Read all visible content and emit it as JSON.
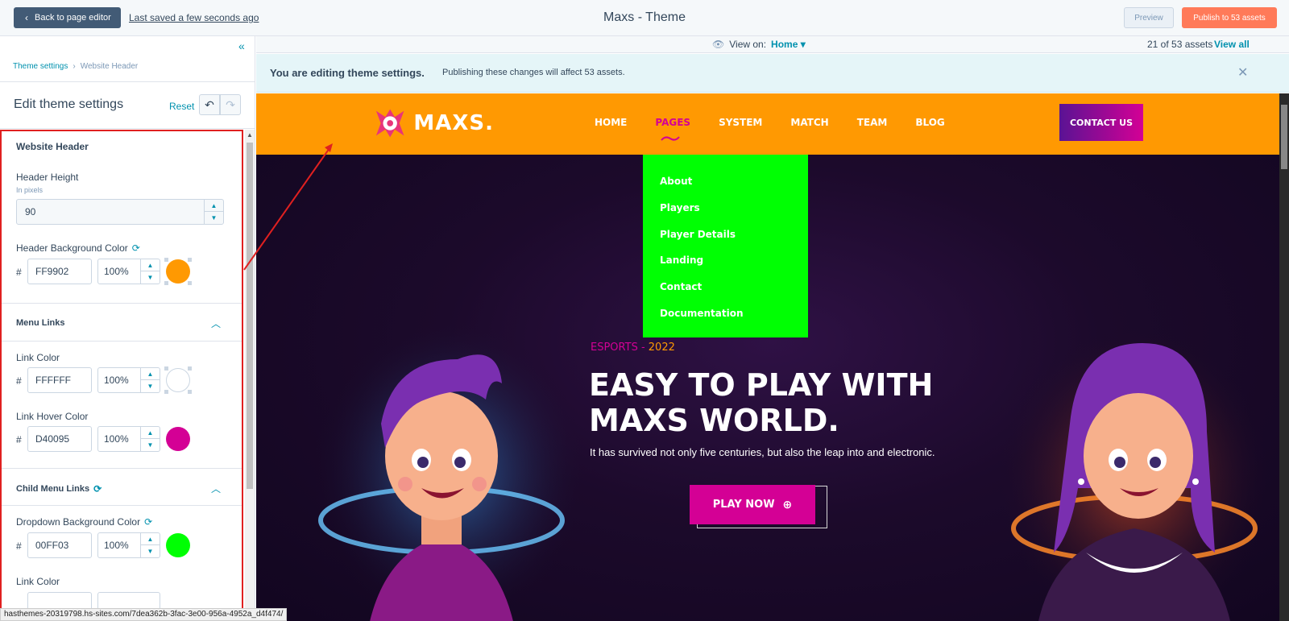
{
  "topbar": {
    "back_label": "Back to page editor",
    "saved_label": "Last saved a few seconds ago",
    "app_title": "Maxs - Theme",
    "preview_label": "Preview",
    "publish_label": "Publish to 53 assets"
  },
  "sidebar": {
    "breadcrumb": [
      "Theme settings",
      "Website Header"
    ],
    "title": "Edit theme settings",
    "reset_label": "Reset",
    "sections": {
      "website_header": {
        "title": "Website Header",
        "height_label": "Header Height",
        "height_sub": "In pixels",
        "height_value": "90",
        "bg_label": "Header Background Color",
        "bg_hex": "FF9902",
        "bg_opacity": "100%",
        "bg_color": "#ff9902"
      },
      "menu_links": {
        "title": "Menu Links",
        "link_label": "Link Color",
        "link_hex": "FFFFFF",
        "link_opacity": "100%",
        "link_color": "#ffffff",
        "hover_label": "Link Hover Color",
        "hover_hex": "D40095",
        "hover_opacity": "100%",
        "hover_color": "#d40095"
      },
      "child_menu_links": {
        "title": "Child Menu Links",
        "dropdown_label": "Dropdown Background Color",
        "dropdown_hex": "00FF03",
        "dropdown_opacity": "100%",
        "dropdown_color": "#00ff03",
        "link_label": "Link Color"
      }
    }
  },
  "viewbar": {
    "view_on_label": "View on:",
    "view_on_value": "Home",
    "assets_count": "21 of 53 assets",
    "view_all_label": "View all"
  },
  "notice": {
    "title": "You are editing theme settings.",
    "text": "Publishing these changes will affect 53 assets."
  },
  "site": {
    "logo_text": "MAXS.",
    "nav": [
      "HOME",
      "PAGES",
      "SYSTEM",
      "MATCH",
      "TEAM",
      "BLOG"
    ],
    "active_nav": "PAGES",
    "contact_label": "CONTACT US",
    "dropdown": [
      "About",
      "Players",
      "Player Details",
      "Landing",
      "Contact",
      "Documentation"
    ],
    "esports_label": "ESPORTS - ",
    "esports_year": "2022",
    "hero_title_line1": "EASY TO PLAY WITH",
    "hero_title_line2": "MAXS WORLD.",
    "hero_sub": "It has survived not only five centuries, but also the leap into and electronic.",
    "play_label": "PLAY NOW"
  },
  "status_url": "hasthemes-20319798.hs-sites.com/7dea362b-3fac-3e00-956a-4952a_d4f474/",
  "colors": {
    "accent": "#0091ae",
    "brand_orange": "#ff7a59",
    "highlight_red": "#e02020"
  }
}
